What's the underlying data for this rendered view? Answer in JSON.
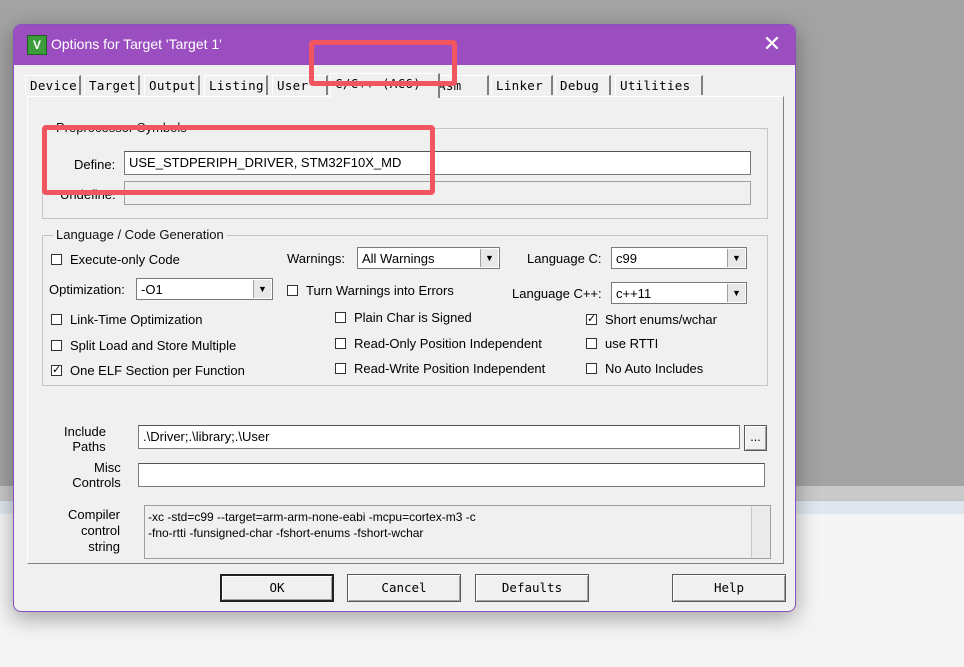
{
  "window": {
    "title": "Options for Target 'Target 1'",
    "app_icon_glyph": "V",
    "close_glyph": "✕"
  },
  "tabs": [
    "Device",
    "Target",
    "Output",
    "Listing",
    "User",
    "C/C++ (AC6)",
    "Asm",
    "Linker",
    "Debug",
    "Utilities"
  ],
  "preprocessor": {
    "legend": "Preprocessor Symbols",
    "define_label": "Define:",
    "define_value": "USE_STDPERIPH_DRIVER, STM32F10X_MD",
    "undefine_label": "Undefine:",
    "undefine_value": ""
  },
  "codegen": {
    "legend": "Language / Code Generation",
    "execute_only": {
      "label": "Execute-only Code",
      "checked": false
    },
    "warnings_label": "Warnings:",
    "warnings_value": "All Warnings",
    "language_c_label": "Language C:",
    "language_c_value": "c99",
    "optimization_label": "Optimization:",
    "optimization_value": "-O1",
    "turn_warnings": {
      "label": "Turn Warnings into Errors",
      "checked": false
    },
    "language_cpp_label": "Language C++:",
    "language_cpp_value": "c++11",
    "lto": {
      "label": "Link-Time Optimization",
      "checked": false
    },
    "plain_char": {
      "label": "Plain Char is Signed",
      "checked": false
    },
    "short_enums": {
      "label": "Short enums/wchar",
      "checked": true
    },
    "split_load": {
      "label": "Split Load and Store Multiple",
      "checked": false
    },
    "ropi": {
      "label": "Read-Only Position Independent",
      "checked": false
    },
    "rtti": {
      "label": "use RTTI",
      "checked": false
    },
    "one_elf": {
      "label": "One ELF Section per Function",
      "checked": true
    },
    "rwpi": {
      "label": "Read-Write Position Independent",
      "checked": false
    },
    "no_auto": {
      "label": "No Auto Includes",
      "checked": false
    }
  },
  "include": {
    "label_line1": "Include",
    "label_line2": "Paths",
    "value": ".\\Driver;.\\library;.\\User",
    "browse_label": "..."
  },
  "misc": {
    "label_line1": "Misc",
    "label_line2": "Controls",
    "value": ""
  },
  "compiler": {
    "label_line1": "Compiler",
    "label_line2": "control",
    "label_line3": "string",
    "line1": "-xc -std=c99 --target=arm-arm-none-eabi -mcpu=cortex-m3 -c",
    "line2": "-fno-rtti -funsigned-char -fshort-enums -fshort-wchar"
  },
  "buttons": {
    "ok": "OK",
    "cancel": "Cancel",
    "defaults": "Defaults",
    "help": "Help"
  },
  "colors": {
    "titlebar": "#9b4ec0",
    "highlight": "#f05560"
  }
}
